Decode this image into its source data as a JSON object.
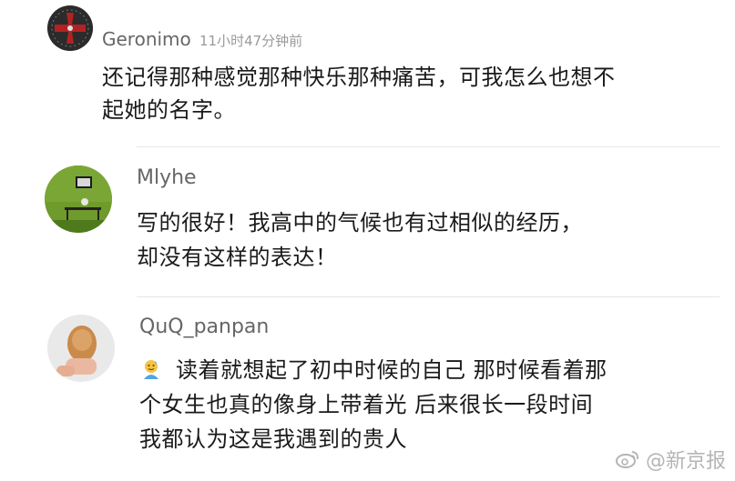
{
  "comments": [
    {
      "username": "Geronimo",
      "time": "11小时47分钟前",
      "lines": [
        "还记得那种感觉那种快乐那种痛苦，可我怎么也想不",
        "起她的名字。"
      ]
    },
    {
      "username": "Mlyhe",
      "lines": [
        "写的很好！我高中的气候也有过相似的经历，",
        "却没有这样的表达！"
      ]
    },
    {
      "username": "QuQ_panpan",
      "lines": [
        "读着就想起了初中时候的自己 那时候看着那",
        "个女生也真的像身上带着光 后来很长一段时间",
        "我都认为这是我遇到的贵人"
      ]
    }
  ],
  "watermark": {
    "text": "@新京报",
    "icon": "weibo-icon"
  },
  "colors": {
    "username": "#666666",
    "time": "#9a9a9a",
    "divider": "#e6e6e6",
    "watermark": "#b5b5b5"
  }
}
